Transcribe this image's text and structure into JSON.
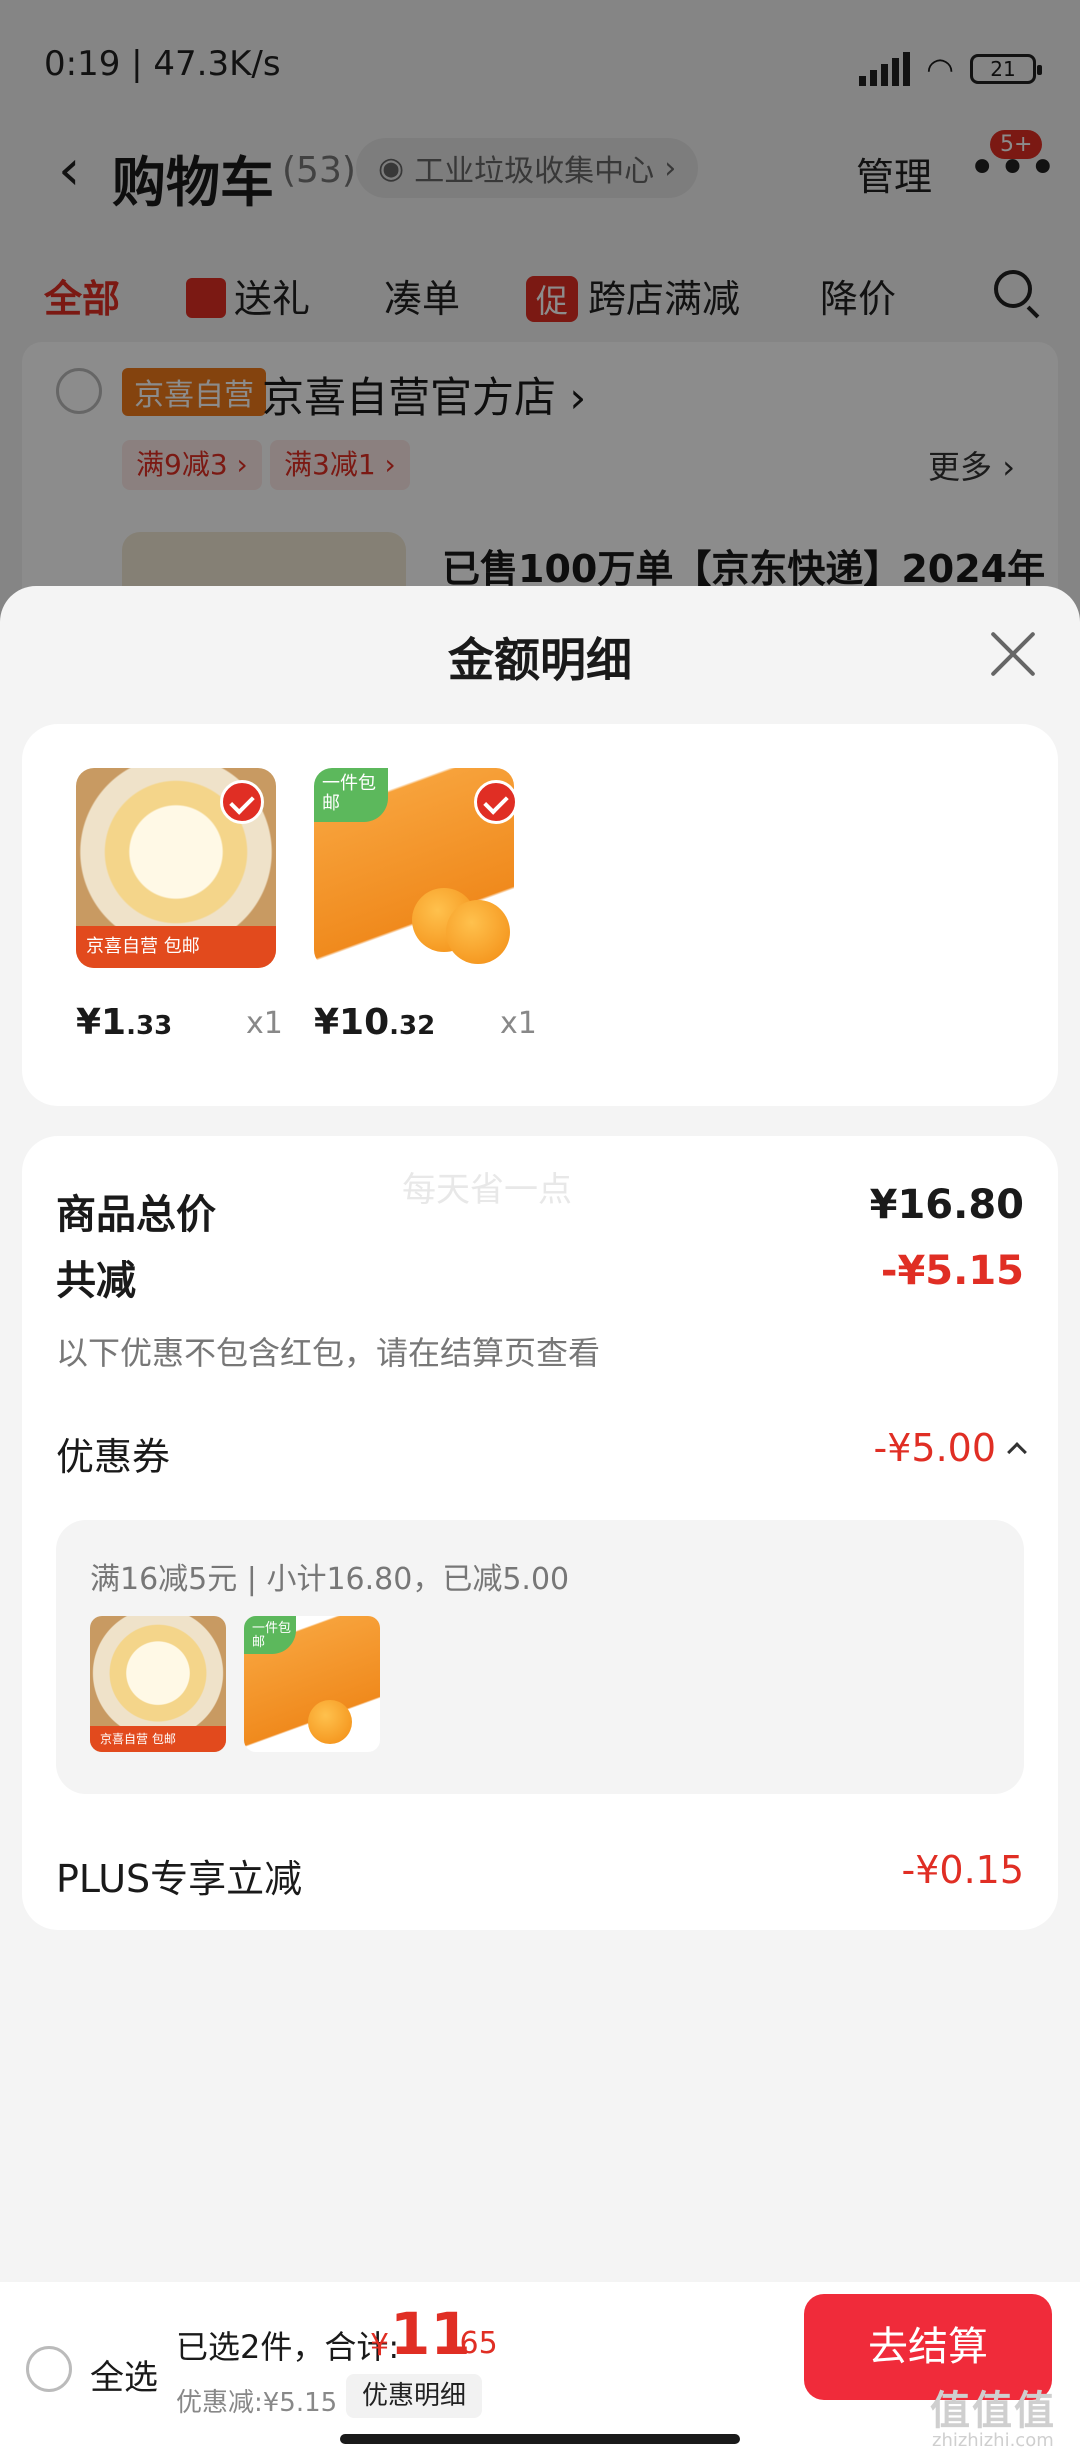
{
  "status_bar": {
    "time_speed": "0:19 | 47.3K/s",
    "battery": "21"
  },
  "cart_header": {
    "title": "购物车",
    "count": "(53)",
    "address": "工业垃圾收集中心",
    "manage": "管理",
    "message_badge": "5+"
  },
  "cart_tabs": {
    "all": "全部",
    "gift": "送礼",
    "bundle": "凑单",
    "promo_icon": "促",
    "cross_store": "跨店满减",
    "price_drop": "降价"
  },
  "store": {
    "tag": "京喜自营",
    "name": "京喜自营官方店",
    "chips": [
      "满9减3",
      "满3减1"
    ],
    "more": "更多",
    "product_title": "已售100万单【京东快递】2024年"
  },
  "sheet": {
    "title": "金额明细",
    "items": [
      {
        "price_int": "¥1",
        "price_dec": ".33",
        "qty": "x1",
        "badge": "包邮",
        "tag": "京喜自营"
      },
      {
        "price_int": "¥10",
        "price_dec": ".32",
        "qty": "x1",
        "badge": "一件包邮"
      }
    ],
    "watermark": "每天省一点",
    "total_label": "商品总价",
    "total_value": "¥16.80",
    "discount_label": "共减",
    "discount_value": "-¥5.15",
    "discount_note": "以下优惠不包含红包，请在结算页查看",
    "coupon_label": "优惠券",
    "coupon_value": "-¥5.00",
    "coupon_desc": "满16减5元 | 小计16.80，已减5.00",
    "plus_label": "PLUS专享立减",
    "plus_value": "-¥0.15"
  },
  "bottom_bar": {
    "select_all": "全选",
    "summary": "已选2件，合计:",
    "total_currency": "¥",
    "total_int": "11",
    "total_dec": ".65",
    "saved": "优惠减:¥5.15",
    "detail_button": "优惠明细",
    "checkout": "去结算"
  },
  "watermark_site": {
    "mark": "值值值",
    "url": "zhizhizhi.com"
  },
  "colors": {
    "accent_red": "#e02e24",
    "checkout_red": "#f02b3a",
    "store_tag_orange": "#f07a1a"
  }
}
